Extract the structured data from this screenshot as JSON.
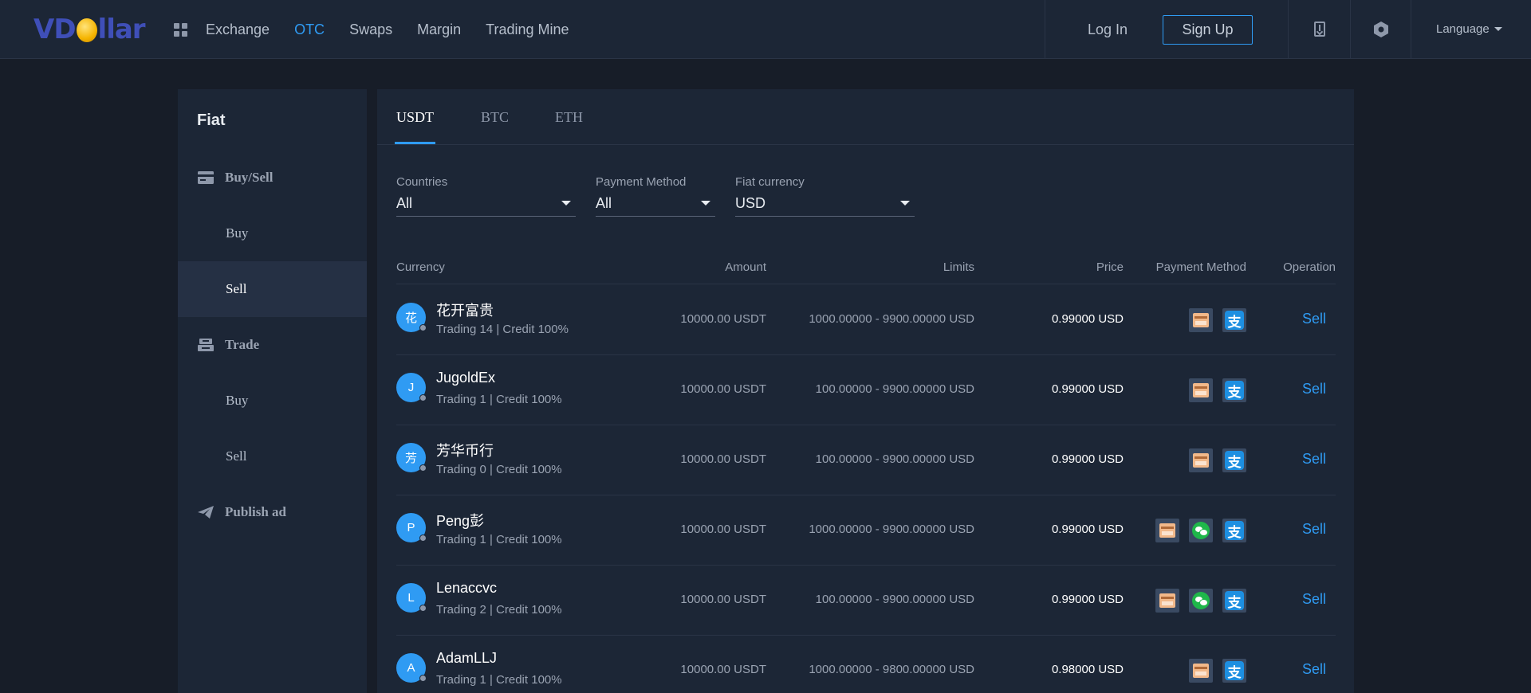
{
  "header": {
    "logo": {
      "pre": "VD",
      "post": "llar"
    },
    "nav": [
      "Exchange",
      "OTC",
      "Swaps",
      "Margin",
      "Trading Mine"
    ],
    "nav_active": "OTC",
    "login": "Log In",
    "signup": "Sign Up",
    "language": "Language",
    "accent": "#2f9bf3"
  },
  "sidebar": {
    "title": "Fiat",
    "groups": [
      {
        "label": "Buy/Sell",
        "icon": "card-icon",
        "items": [
          "Buy",
          "Sell"
        ],
        "active": "Sell"
      },
      {
        "label": "Trade",
        "icon": "trade-icon",
        "items": [
          "Buy",
          "Sell"
        ]
      },
      {
        "label": "Publish ad",
        "icon": "paper-plane-icon",
        "items": []
      }
    ]
  },
  "tabs": [
    "USDT",
    "BTC",
    "ETH"
  ],
  "tab_active": "USDT",
  "filters": {
    "countries": {
      "label": "Countries",
      "value": "All"
    },
    "payment_method": {
      "label": "Payment Method",
      "value": "All"
    },
    "fiat_currency": {
      "label": "Fiat currency",
      "value": "USD"
    }
  },
  "table": {
    "headers": [
      "Currency",
      "Amount",
      "Limits",
      "Price",
      "Payment Method",
      "Operation"
    ],
    "rows": [
      {
        "initial": "花",
        "name": "花开富贵",
        "stats": "Trading 14 | Credit 100%",
        "amount": "10000.00 USDT",
        "limits": "1000.00000 - 9900.00000 USD",
        "price": "0.99000 USD",
        "payments": [
          "bank",
          "alipay"
        ],
        "op": "Sell"
      },
      {
        "initial": "J",
        "name": "JugoldEx",
        "stats": "Trading 1 | Credit 100%",
        "amount": "10000.00 USDT",
        "limits": "100.00000 - 9900.00000 USD",
        "price": "0.99000 USD",
        "payments": [
          "bank",
          "alipay"
        ],
        "op": "Sell"
      },
      {
        "initial": "芳",
        "name": "芳华币行",
        "stats": "Trading 0 | Credit 100%",
        "amount": "10000.00 USDT",
        "limits": "100.00000 - 9900.00000 USD",
        "price": "0.99000 USD",
        "payments": [
          "bank",
          "alipay"
        ],
        "op": "Sell"
      },
      {
        "initial": "P",
        "name": "Peng彭",
        "stats": "Trading 1 | Credit 100%",
        "amount": "10000.00 USDT",
        "limits": "1000.00000 - 9900.00000 USD",
        "price": "0.99000 USD",
        "payments": [
          "bank",
          "wechat",
          "alipay"
        ],
        "op": "Sell"
      },
      {
        "initial": "L",
        "name": "Lenaccvc",
        "stats": "Trading 2 | Credit 100%",
        "amount": "10000.00 USDT",
        "limits": "100.00000 - 9900.00000 USD",
        "price": "0.99000 USD",
        "payments": [
          "bank",
          "wechat",
          "alipay"
        ],
        "op": "Sell"
      },
      {
        "initial": "A",
        "name": "AdamLLJ",
        "stats": "Trading 1 | Credit 100%",
        "amount": "10000.00 USDT",
        "limits": "1000.00000 - 9800.00000 USD",
        "price": "0.98000 USD",
        "payments": [
          "bank",
          "alipay"
        ],
        "op": "Sell"
      }
    ]
  },
  "alipay_glyph": "支"
}
